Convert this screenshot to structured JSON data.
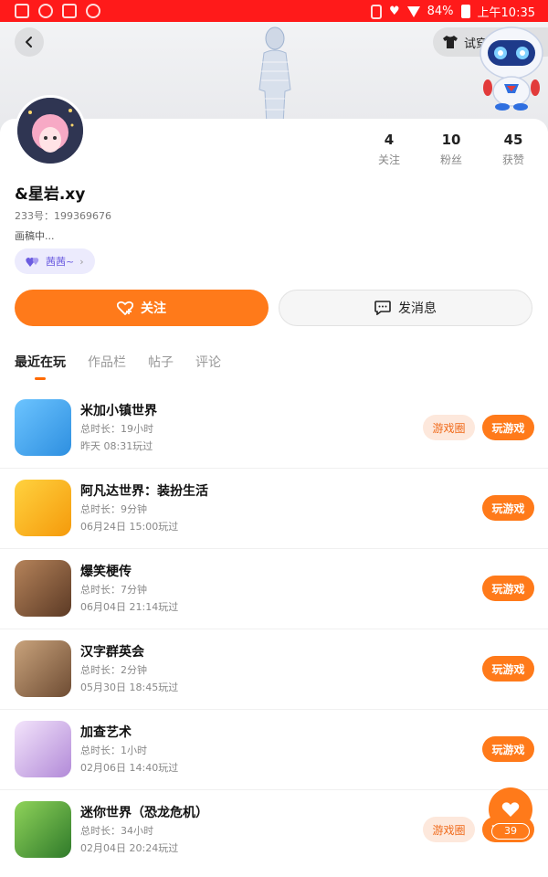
{
  "status_bar": {
    "battery": "84%",
    "time": "上午10:35"
  },
  "header": {
    "try_on_label": "试穿"
  },
  "profile": {
    "username": "&星岩.xy",
    "user_id": "233号：199369676",
    "bio": "画稿中...",
    "tag_label": "茜茜~",
    "stats": [
      {
        "value": "4",
        "label": "关注"
      },
      {
        "value": "10",
        "label": "粉丝"
      },
      {
        "value": "45",
        "label": "获赞"
      }
    ]
  },
  "actions": {
    "follow_label": "关注",
    "message_label": "发消息"
  },
  "tabs": [
    {
      "label": "最近在玩",
      "active": true
    },
    {
      "label": "作品栏",
      "active": false
    },
    {
      "label": "帖子",
      "active": false
    },
    {
      "label": "评论",
      "active": false
    }
  ],
  "games": [
    {
      "name": "米加小镇世界",
      "duration": "总时长：19小时",
      "last_played": "昨天 08:31玩过",
      "circle_label": "游戏圈",
      "play_label": "玩游戏",
      "has_circle": true,
      "icon_color": "#3aa0f0"
    },
    {
      "name": "阿凡达世界：装扮生活",
      "duration": "总时长：9分钟",
      "last_played": "06月24日 15:00玩过",
      "circle_label": "",
      "play_label": "玩游戏",
      "has_circle": false,
      "icon_color": "#f6b81c"
    },
    {
      "name": "爆笑梗传",
      "duration": "总时长：7分钟",
      "last_played": "06月04日 21:14玩过",
      "circle_label": "",
      "play_label": "玩游戏",
      "has_circle": false,
      "icon_color": "#8a5a3c"
    },
    {
      "name": "汉字群英会",
      "duration": "总时长：2分钟",
      "last_played": "05月30日 18:45玩过",
      "circle_label": "",
      "play_label": "玩游戏",
      "has_circle": false,
      "icon_color": "#7a5a40"
    },
    {
      "name": "加查艺术",
      "duration": "总时长：1小时",
      "last_played": "02月06日 14:40玩过",
      "circle_label": "",
      "play_label": "玩游戏",
      "has_circle": false,
      "icon_color": "#c7a6e8"
    },
    {
      "name": "迷你世界（恐龙危机）",
      "duration": "总时长：34小时",
      "last_played": "02月04日 20:24玩过",
      "circle_label": "游戏圈",
      "play_label": "玩游戏",
      "has_circle": true,
      "icon_color": "#4a9a3a"
    }
  ],
  "fab": {
    "count": "39"
  }
}
